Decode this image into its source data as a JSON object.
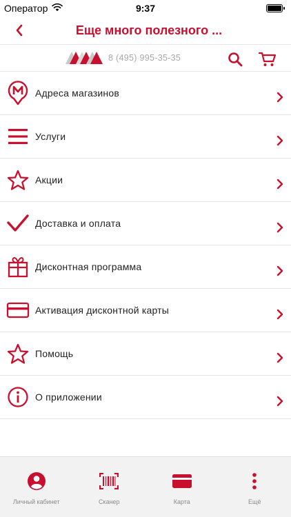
{
  "status_bar": {
    "carrier": "Оператор",
    "time": "9:37"
  },
  "nav": {
    "title": "Еще много полезного ..."
  },
  "subheader": {
    "phone": "8 (495) 995-35-35"
  },
  "menu": [
    {
      "label": "Адреса магазинов",
      "icon": "metro-pin-icon"
    },
    {
      "label": "Услуги",
      "icon": "menu-lines-icon"
    },
    {
      "label": "Акции",
      "icon": "star-icon"
    },
    {
      "label": "Доставка и оплата",
      "icon": "checkmark-icon"
    },
    {
      "label": "Дисконтная программа",
      "icon": "gift-icon"
    },
    {
      "label": "Активация дисконтной карты",
      "icon": "card-icon"
    },
    {
      "label": "Помощь",
      "icon": "star-icon"
    },
    {
      "label": "О приложении",
      "icon": "info-icon"
    }
  ],
  "tabs": [
    {
      "label": "Личный кабинет",
      "icon": "user-icon"
    },
    {
      "label": "Сканер",
      "icon": "barcode-scanner-icon"
    },
    {
      "label": "Карта",
      "icon": "card-icon"
    },
    {
      "label": "Ещё",
      "icon": "more-dots-icon"
    }
  ],
  "colors": {
    "accent": "#c8102e",
    "divider": "#e3e3e3",
    "tab_bar_bg": "#f2f2f2",
    "phone_text": "#a7a7a7"
  }
}
